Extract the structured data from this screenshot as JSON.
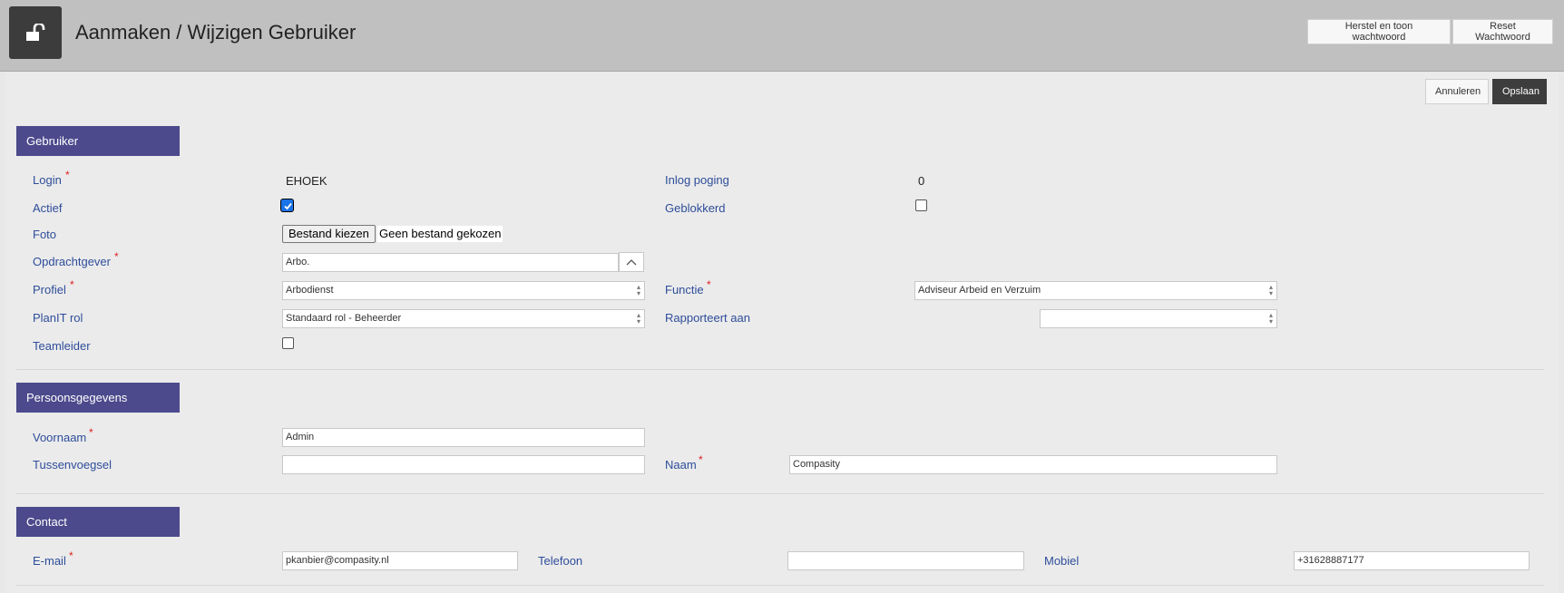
{
  "header": {
    "title": "Aanmaken / Wijzigen Gebruiker",
    "icon": "unlock-icon",
    "buttons": {
      "reset_show": "Herstel en toon wachtwoord",
      "reset": "Reset Wachtwoord"
    }
  },
  "actions": {
    "cancel": "Annuleren",
    "save": "Opslaan"
  },
  "sections": {
    "user": {
      "title": "Gebruiker",
      "login_label": "Login",
      "login_value": "EHOEK",
      "attempt_label": "Inlog poging",
      "attempt_value": "0",
      "active_label": "Actief",
      "active_checked": true,
      "blocked_label": "Geblokkerd",
      "blocked_checked": false,
      "photo_label": "Foto",
      "file_button": "Bestand kiezen",
      "file_status": "Geen bestand gekozen",
      "client_label": "Opdrachtgever",
      "client_value": "Arbo.",
      "profile_label": "Profiel",
      "profile_value": "Arbodienst",
      "function_label": "Functie",
      "function_value": "Adviseur Arbeid en Verzuim",
      "role_label": "PlanIT rol",
      "role_value": "Standaard rol - Beheerder",
      "reports_label": "Rapporteert aan",
      "reports_value": "",
      "teamlead_label": "Teamleider",
      "teamlead_checked": false
    },
    "person": {
      "title": "Persoonsgegevens",
      "firstname_label": "Voornaam",
      "firstname_value": "Admin",
      "infix_label": "Tussenvoegsel",
      "infix_value": "",
      "lastname_label": "Naam",
      "lastname_value": "Compasity"
    },
    "contact": {
      "title": "Contact",
      "email_label": "E-mail",
      "email_value": "pkanbier@compasity.nl",
      "phone_label": "Telefoon",
      "phone_value": "",
      "mobile_label": "Mobiel",
      "mobile_value": "+31628887177"
    }
  },
  "colors": {
    "section_header": "#4c4a8c",
    "label": "#2e4d9a",
    "required": "#e02020",
    "header_bg": "#c0c0c0",
    "save_button": "#3d3d3d"
  }
}
